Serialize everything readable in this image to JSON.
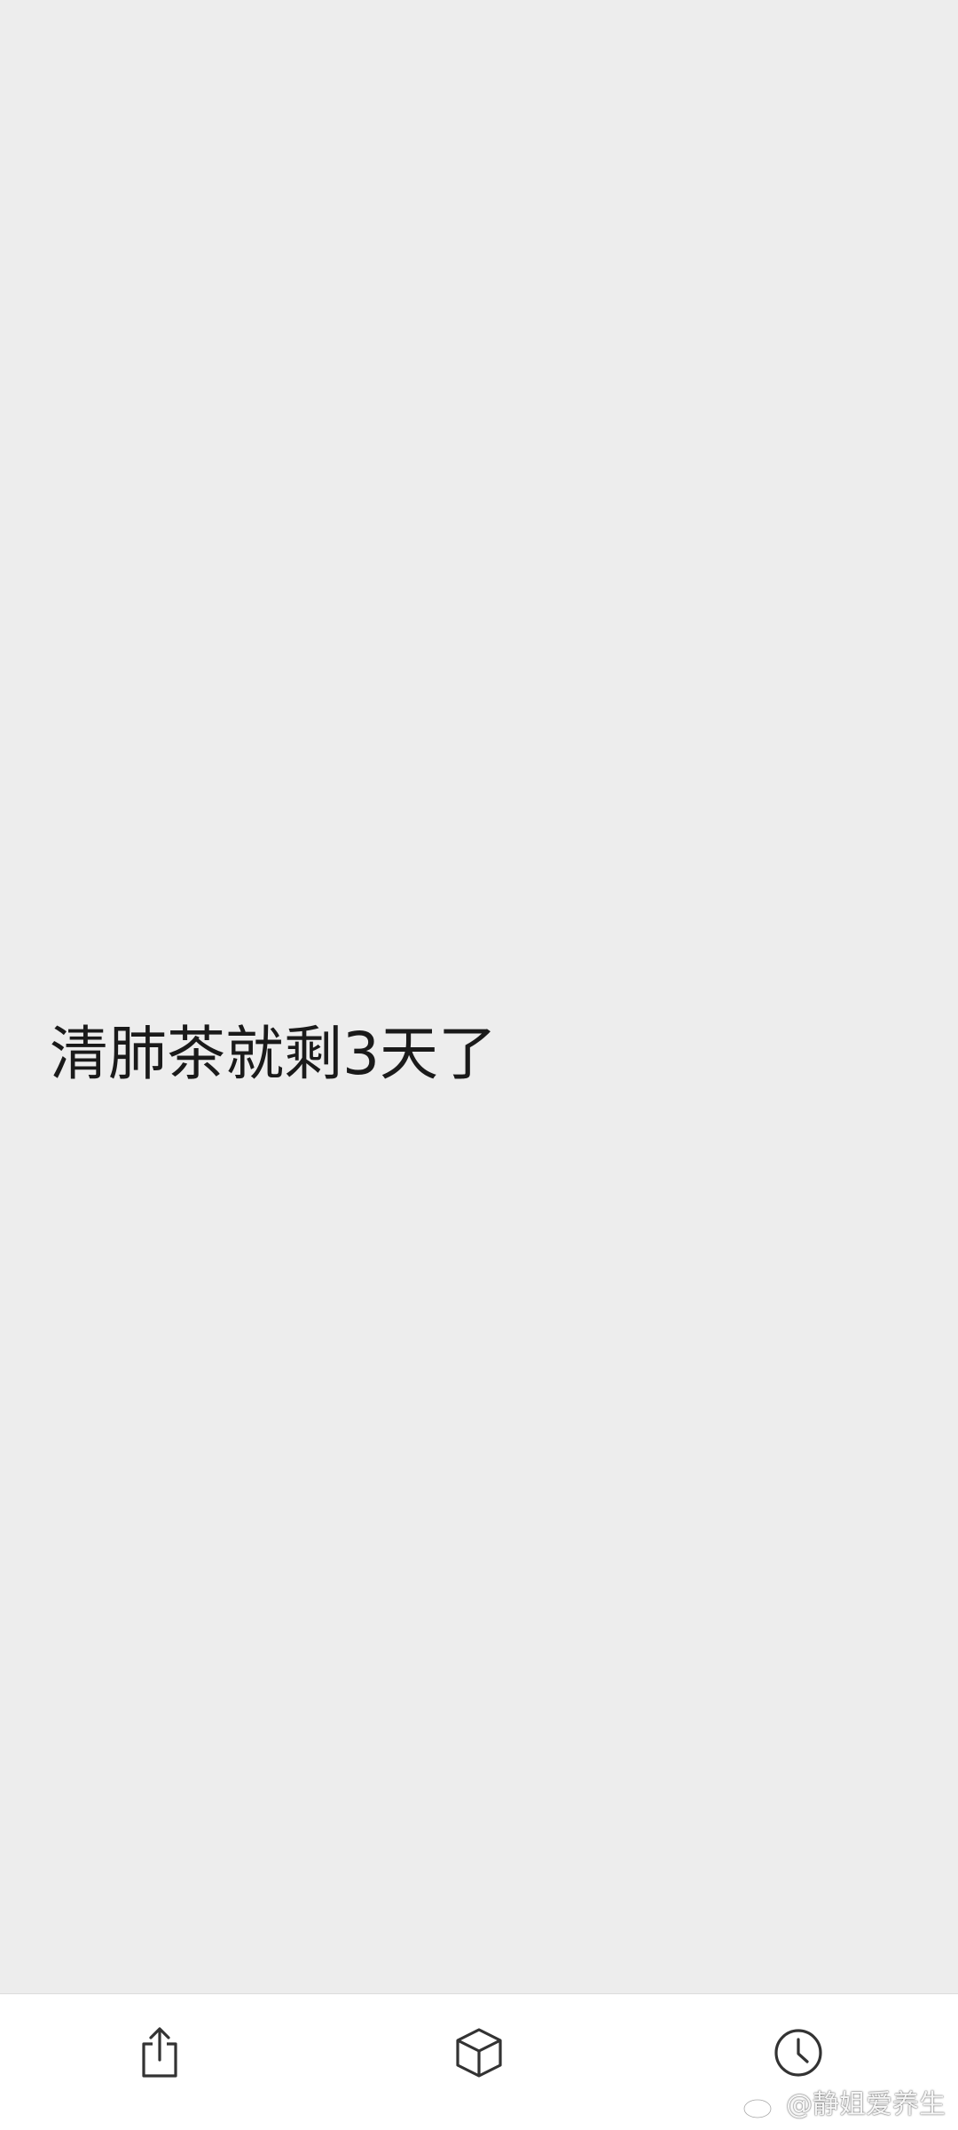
{
  "message": {
    "text": "清肺茶就剩3天了"
  },
  "toolbar": {
    "buttons": [
      {
        "icon": "share-icon"
      },
      {
        "icon": "cube-icon"
      },
      {
        "icon": "clock-icon"
      }
    ]
  },
  "watermark": {
    "text": "@静姐爱养生",
    "logo": "weibo-logo"
  },
  "colors": {
    "background": "#ededed",
    "toolbar": "#ffffff",
    "text": "#1a1a1a",
    "icon": "#333333"
  }
}
